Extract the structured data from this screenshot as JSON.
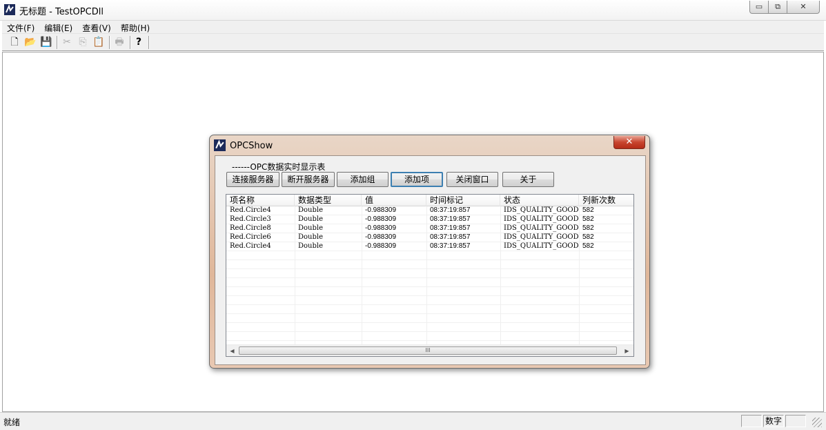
{
  "main_window": {
    "title": "无标题 - TestOPCDll",
    "controls": {
      "minimize": "▭",
      "maximize": "⧉",
      "close": "✕"
    }
  },
  "menu": [
    "文件(F)",
    "编辑(E)",
    "查看(V)",
    "帮助(H)"
  ],
  "toolbar": {
    "new": "🗋",
    "open": "📂",
    "save": "💾",
    "cut": "✂",
    "copy": "⎘",
    "paste": "📋",
    "print": "🖶",
    "help": "?"
  },
  "status_bar": {
    "text": "就绪",
    "pane_numlock": "数字"
  },
  "dialog": {
    "title": "OPCShow",
    "close": "✕",
    "caption": "------OPC数据实时显示表",
    "buttons": {
      "connect": "连接服务器",
      "disconnect": "断开服务器",
      "add_group": "添加组",
      "add_item": "添加项",
      "close_window": "关闭窗口",
      "about": "关于"
    },
    "columns": [
      "项名称",
      "数据类型",
      "值",
      "时间标记",
      "状态",
      "列新次数"
    ],
    "rows": [
      [
        "Red.Circle4",
        "Double",
        "-0.988309",
        "08:37:19:857",
        "IDS_QUALITY_GOOD",
        "582"
      ],
      [
        "Red.Circle3",
        "Double",
        "-0.988309",
        "08:37:19:857",
        "IDS_QUALITY_GOOD",
        "582"
      ],
      [
        "Red.Circle8",
        "Double",
        "-0.988309",
        "08:37:19:857",
        "IDS_QUALITY_GOOD",
        "582"
      ],
      [
        "Red.Circle6",
        "Double",
        "-0.988309",
        "08:37:19:857",
        "IDS_QUALITY_GOOD",
        "582"
      ],
      [
        "Red.Circle4",
        "Double",
        "-0.988309",
        "08:37:19:857",
        "IDS_QUALITY_GOOD",
        "582"
      ]
    ],
    "scrollbar": {
      "left_arrow": "◀",
      "right_arrow": "▶",
      "thumb_grip": "III"
    }
  },
  "colors": {
    "dialog_frame": "#e0b79a",
    "close_button": "#c8452f",
    "default_button_border": "#3c7fb1"
  }
}
